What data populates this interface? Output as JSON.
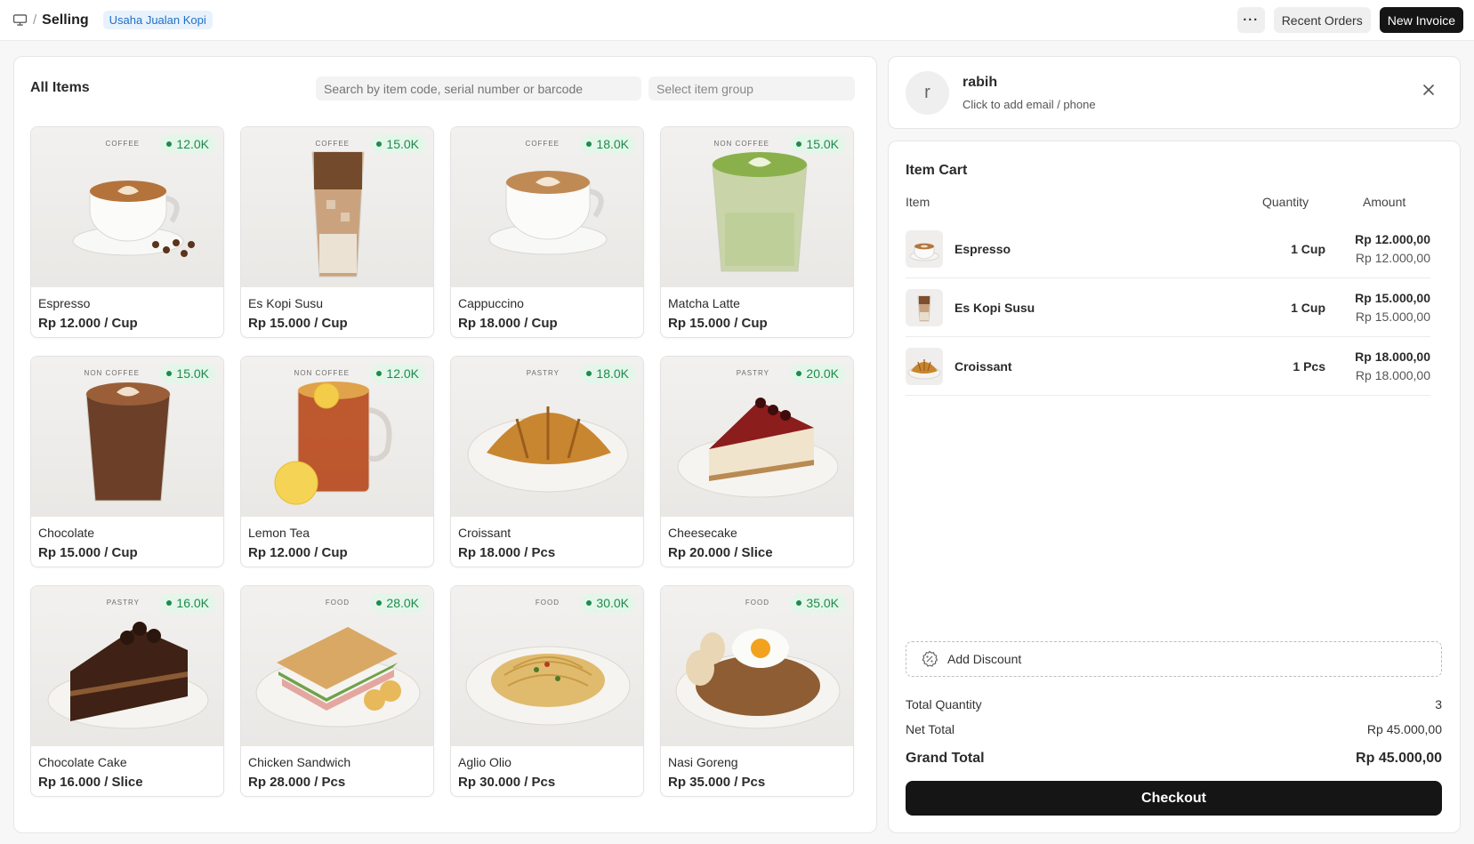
{
  "topbar": {
    "title": "Selling",
    "company": "Usaha Jualan Kopi",
    "more_label": "···",
    "recent_orders": "Recent Orders",
    "new_invoice": "New Invoice"
  },
  "items_panel": {
    "title": "All Items",
    "search_placeholder": "Search by item code, serial number or barcode",
    "group_placeholder": "Select item group",
    "items": [
      {
        "name": "Espresso",
        "rate": "Rp 12.000 / Cup",
        "category": "COFFEE",
        "badge": "12.0K",
        "icon": "espresso-cup-icon"
      },
      {
        "name": "Es Kopi Susu",
        "rate": "Rp 15.000 / Cup",
        "category": "COFFEE",
        "badge": "15.0K",
        "icon": "iced-coffee-glass-icon"
      },
      {
        "name": "Cappuccino",
        "rate": "Rp 18.000 / Cup",
        "category": "COFFEE",
        "badge": "18.0K",
        "icon": "cappuccino-cup-icon"
      },
      {
        "name": "Matcha Latte",
        "rate": "Rp 15.000 / Cup",
        "category": "NON COFFEE",
        "badge": "15.0K",
        "icon": "matcha-glass-icon"
      },
      {
        "name": "Chocolate",
        "rate": "Rp 15.000 / Cup",
        "category": "NON COFFEE",
        "badge": "15.0K",
        "icon": "chocolate-glass-icon"
      },
      {
        "name": "Lemon Tea",
        "rate": "Rp 12.000 / Cup",
        "category": "NON COFFEE",
        "badge": "12.0K",
        "icon": "lemon-tea-mug-icon"
      },
      {
        "name": "Croissant",
        "rate": "Rp 18.000 / Pcs",
        "category": "PASTRY",
        "badge": "18.0K",
        "icon": "croissant-icon"
      },
      {
        "name": "Cheesecake",
        "rate": "Rp 20.000 / Slice",
        "category": "PASTRY",
        "badge": "20.0K",
        "icon": "cheesecake-icon"
      },
      {
        "name": "Chocolate Cake",
        "rate": "Rp 16.000 / Slice",
        "category": "PASTRY",
        "badge": "16.0K",
        "icon": "chocolate-cake-icon"
      },
      {
        "name": "Chicken Sandwich",
        "rate": "Rp 28.000 / Pcs",
        "category": "FOOD",
        "badge": "28.0K",
        "icon": "sandwich-icon"
      },
      {
        "name": "Aglio Olio",
        "rate": "Rp 30.000 / Pcs",
        "category": "FOOD",
        "badge": "30.0K",
        "icon": "pasta-icon"
      },
      {
        "name": "Nasi Goreng",
        "rate": "Rp 35.000 / Pcs",
        "category": "FOOD",
        "badge": "35.0K",
        "icon": "fried-rice-icon"
      }
    ]
  },
  "customer": {
    "initial": "r",
    "name": "rabih",
    "subtitle": "Click to add email / phone"
  },
  "cart": {
    "title": "Item Cart",
    "col_item": "Item",
    "col_qty": "Quantity",
    "col_amount": "Amount",
    "rows": [
      {
        "name": "Espresso",
        "qty": "1 Cup",
        "amount": "Rp 12.000,00",
        "rate": "Rp 12.000,00"
      },
      {
        "name": "Es Kopi Susu",
        "qty": "1 Cup",
        "amount": "Rp 15.000,00",
        "rate": "Rp 15.000,00"
      },
      {
        "name": "Croissant",
        "qty": "1 Pcs",
        "amount": "Rp 18.000,00",
        "rate": "Rp 18.000,00"
      }
    ],
    "add_discount": "Add Discount",
    "total_qty_label": "Total Quantity",
    "total_qty": "3",
    "net_total_label": "Net Total",
    "net_total": "Rp 45.000,00",
    "grand_total_label": "Grand Total",
    "grand_total": "Rp 45.000,00",
    "checkout": "Checkout"
  },
  "colors": {
    "accent_dark": "#151515",
    "badge_green": "#1f8a4c",
    "badge_bg": "#e4f6ea",
    "company_blue": "#1f6fc4"
  }
}
